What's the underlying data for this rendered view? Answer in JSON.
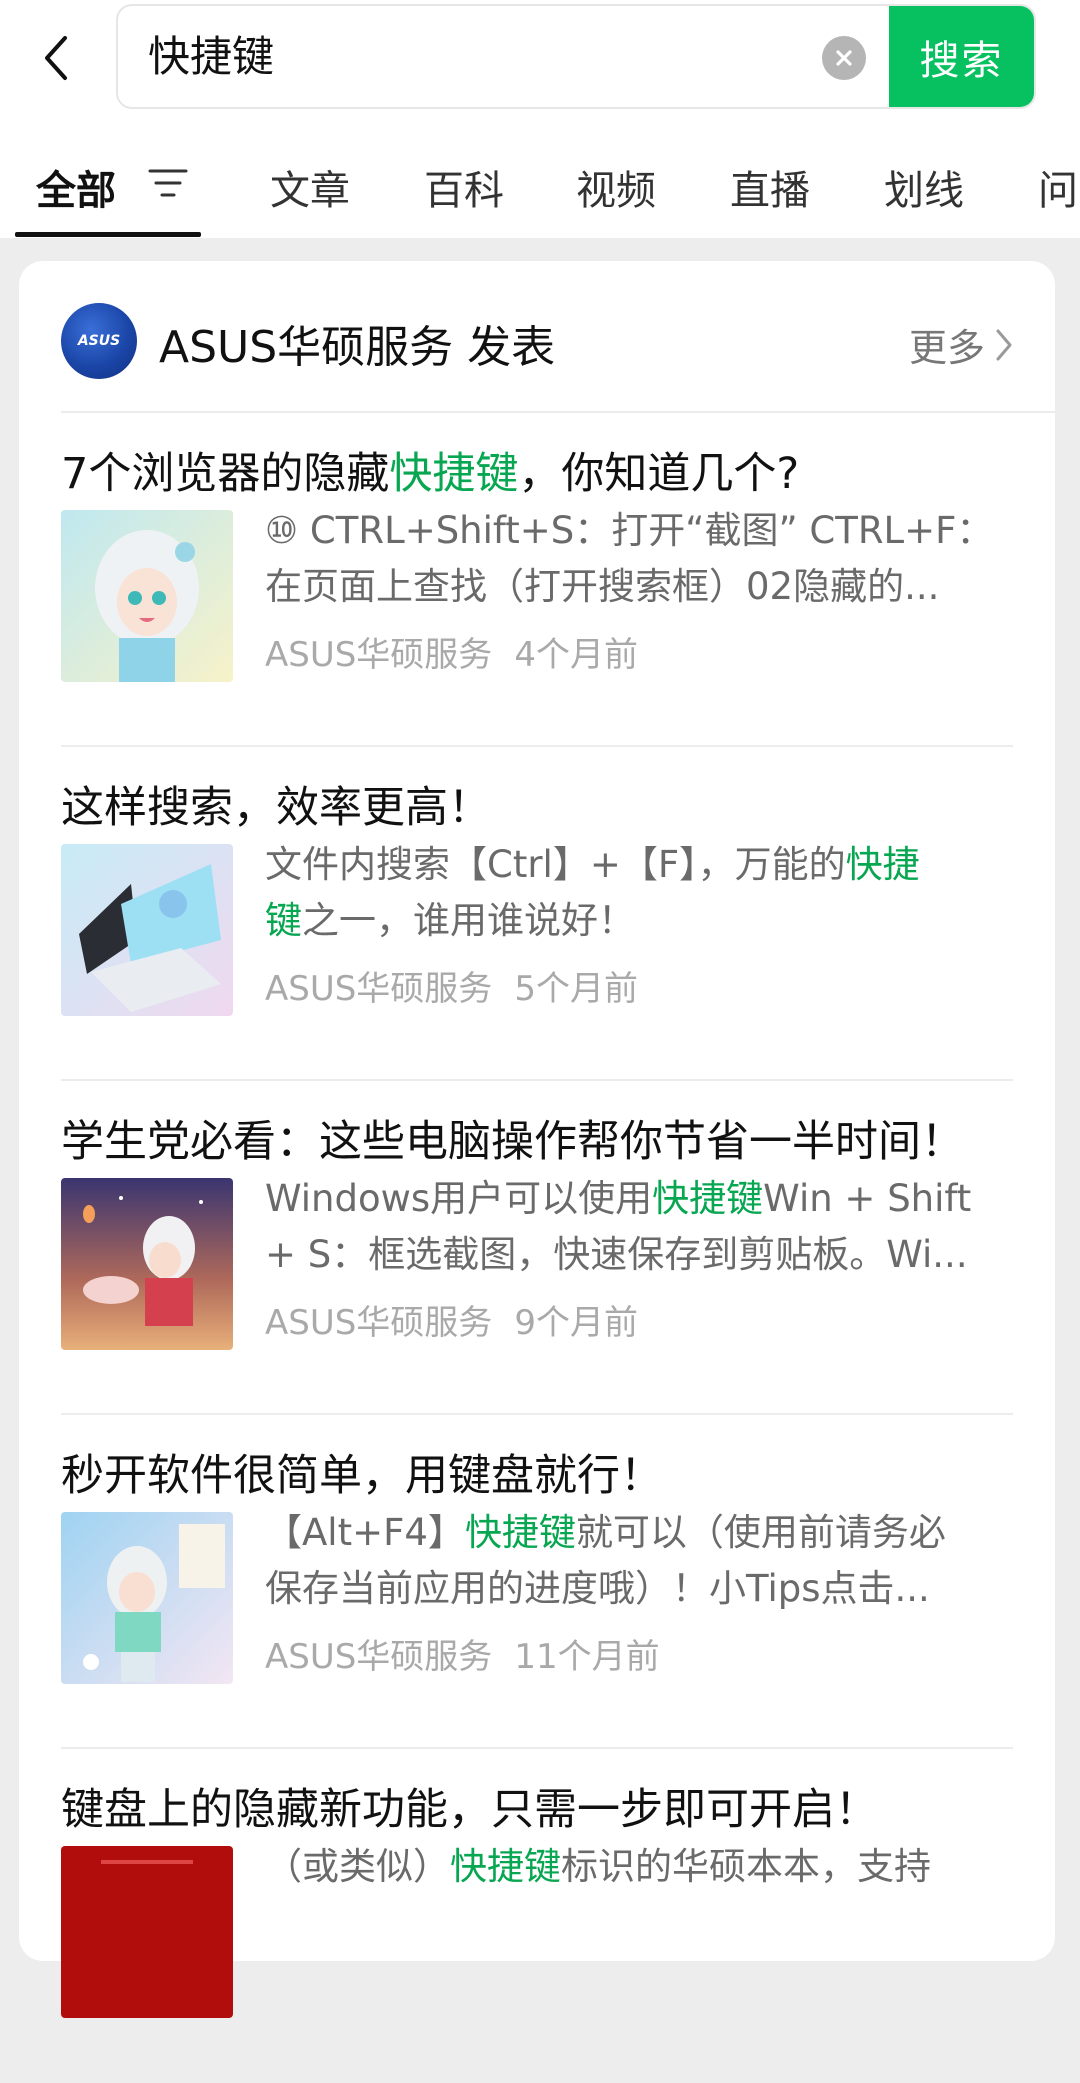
{
  "search": {
    "query": "快捷键",
    "button_label": "搜索"
  },
  "tabs": [
    {
      "label": "全部",
      "active": true
    },
    {
      "label": "文章"
    },
    {
      "label": "百科"
    },
    {
      "label": "视频"
    },
    {
      "label": "直播"
    },
    {
      "label": "划线"
    },
    {
      "label": "问"
    }
  ],
  "author": {
    "avatar_text": "ASUS",
    "name": "ASUS华硕服务 发表",
    "more_label": "更多"
  },
  "colors": {
    "accent": "#07c160",
    "highlight": "#07a650",
    "background": "#ededed"
  },
  "articles": [
    {
      "title_pre": "7个浏览器的隐藏",
      "title_hl": "快捷键",
      "title_post": "，你知道几个?",
      "line1_pre": "⑩ CTRL+Shift+S：打开“截图” CTRL+F：",
      "line1_hl": "",
      "line1_post": "",
      "line2_pre": "在页面上查找（打开搜索框）02隐藏的...",
      "line2_hl": "",
      "line2_post": "",
      "source": "ASUS华硕服务",
      "time": "4个月前"
    },
    {
      "title_pre": "这样搜索，效率更高！",
      "title_hl": "",
      "title_post": "",
      "line1_pre": "文件内搜索【Ctrl】+【F】，万能的",
      "line1_hl": "快捷",
      "line1_post": "",
      "line2_pre": "",
      "line2_hl": "键",
      "line2_post": "之一，谁用谁说好！",
      "source": "ASUS华硕服务",
      "time": "5个月前"
    },
    {
      "title_pre": "学生党必看：这些电脑操作帮你节省一半时间！",
      "title_hl": "",
      "title_post": "",
      "line1_pre": "Windows用户可以使用",
      "line1_hl": "快捷键",
      "line1_post": "Win + Shift",
      "line2_pre": "+ S：框选截图，快速保存到剪贴板。Wi...",
      "line2_hl": "",
      "line2_post": "",
      "source": "ASUS华硕服务",
      "time": "9个月前"
    },
    {
      "title_pre": "秒开软件很简单，用键盘就行！",
      "title_hl": "",
      "title_post": "",
      "line1_pre": "【Alt+F4】",
      "line1_hl": "快捷键",
      "line1_post": "就可以（使用前请务必",
      "line2_pre": "保存当前应用的进度哦）！小Tips点击...",
      "line2_hl": "",
      "line2_post": "",
      "source": "ASUS华硕服务",
      "time": "11个月前"
    },
    {
      "title_pre": "键盘上的隐藏新功能，只需一步即可开启！",
      "title_hl": "",
      "title_post": "",
      "line1_pre": "（或类似）",
      "line1_hl": "快捷键",
      "line1_post": "标识的华硕本本，支持",
      "line2_pre": "",
      "line2_hl": "",
      "line2_post": "",
      "source": "",
      "time": ""
    }
  ]
}
